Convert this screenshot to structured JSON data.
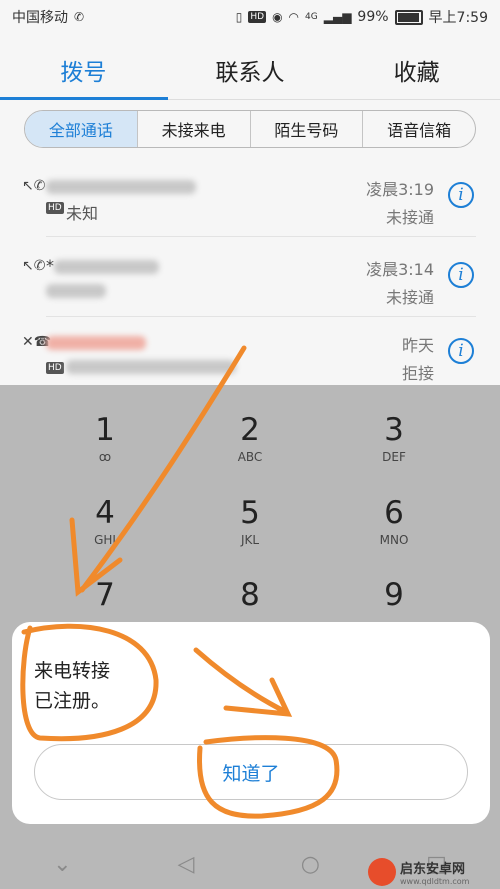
{
  "status": {
    "carrier": "中国移动",
    "battery": "99%",
    "time": "早上7:59",
    "network": "4G",
    "hd": "HD"
  },
  "tabs": [
    {
      "label": "拨号"
    },
    {
      "label": "联系人"
    },
    {
      "label": "收藏"
    }
  ],
  "filters": [
    {
      "label": "全部通话"
    },
    {
      "label": "未接来电"
    },
    {
      "label": "陌生号码"
    },
    {
      "label": "语音信箱"
    }
  ],
  "calls": [
    {
      "name": "",
      "sub": "未知",
      "time": "凌晨3:19",
      "status": "未接通"
    },
    {
      "name": "*",
      "sub": "",
      "time": "凌晨3:14",
      "status": "未接通"
    },
    {
      "name": "",
      "sub": "",
      "time": "昨天",
      "status": "拒接"
    }
  ],
  "keypad": [
    {
      "num": "1",
      "letters": "ꝏ"
    },
    {
      "num": "2",
      "letters": "ABC"
    },
    {
      "num": "3",
      "letters": "DEF"
    },
    {
      "num": "4",
      "letters": "GHI"
    },
    {
      "num": "5",
      "letters": "JKL"
    },
    {
      "num": "6",
      "letters": "MNO"
    },
    {
      "num": "7",
      "letters": ""
    },
    {
      "num": "8",
      "letters": ""
    },
    {
      "num": "9",
      "letters": ""
    }
  ],
  "dialog": {
    "message": "来电转接\n已注册。",
    "button": "知道了"
  },
  "watermark": {
    "name": "启东安卓网",
    "url": "www.qdldtm.com"
  },
  "colors": {
    "accent": "#1d7fd6",
    "annotation": "#f08a2c",
    "missed": "#e04a3a"
  }
}
